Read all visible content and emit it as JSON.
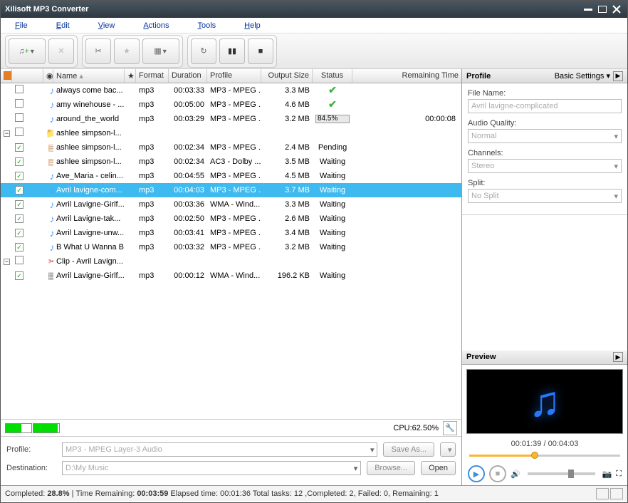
{
  "window": {
    "title": "Xilisoft MP3 Converter"
  },
  "menu": {
    "file": "File",
    "edit": "Edit",
    "view": "View",
    "actions": "Actions",
    "tools": "Tools",
    "help": "Help"
  },
  "columns": {
    "name": "Name",
    "format": "Format",
    "duration": "Duration",
    "profile": "Profile",
    "output": "Output Size",
    "status": "Status",
    "remaining": "Remaining Time"
  },
  "rows": [
    {
      "checked": false,
      "icon": "note",
      "name": "always come bac...",
      "format": "mp3",
      "duration": "00:03:33",
      "profile": "MP3 - MPEG ...",
      "output": "3.3 MB",
      "status": "done"
    },
    {
      "checked": false,
      "icon": "note",
      "name": "amy winehouse - ...",
      "format": "mp3",
      "duration": "00:05:00",
      "profile": "MP3 - MPEG ...",
      "output": "4.6 MB",
      "status": "done"
    },
    {
      "checked": false,
      "icon": "note",
      "name": "around_the_world",
      "format": "mp3",
      "duration": "00:03:29",
      "profile": "MP3 - MPEG ...",
      "output": "3.2 MB",
      "status": "progress",
      "progress": "84.5%",
      "remaining": "00:00:08"
    },
    {
      "checked": false,
      "icon": "folder",
      "name": "ashlee simpson-l...",
      "group": true
    },
    {
      "checked": true,
      "icon": "doc",
      "name": "ashlee simpson-l...",
      "format": "mp3",
      "duration": "00:02:34",
      "profile": "MP3 - MPEG ...",
      "output": "2.4 MB",
      "status": "Pending",
      "indent": true
    },
    {
      "checked": true,
      "icon": "doc",
      "name": "ashlee simpson-l...",
      "format": "mp3",
      "duration": "00:02:34",
      "profile": "AC3 - Dolby ...",
      "output": "3.5 MB",
      "status": "Waiting",
      "indent": true
    },
    {
      "checked": true,
      "icon": "note",
      "name": "Ave_Maria - celin...",
      "format": "mp3",
      "duration": "00:04:55",
      "profile": "MP3 - MPEG ...",
      "output": "4.5 MB",
      "status": "Waiting"
    },
    {
      "checked": true,
      "icon": "note",
      "name": "Avril lavigne-com...",
      "format": "mp3",
      "duration": "00:04:03",
      "profile": "MP3 - MPEG ...",
      "output": "3.7 MB",
      "status": "Waiting",
      "selected": true
    },
    {
      "checked": true,
      "icon": "note",
      "name": "Avril Lavigne-Girlf...",
      "format": "mp3",
      "duration": "00:03:36",
      "profile": "WMA - Wind...",
      "output": "3.3 MB",
      "status": "Waiting"
    },
    {
      "checked": true,
      "icon": "note",
      "name": "Avril Lavigne-tak...",
      "format": "mp3",
      "duration": "00:02:50",
      "profile": "MP3 - MPEG ...",
      "output": "2.6 MB",
      "status": "Waiting"
    },
    {
      "checked": true,
      "icon": "note",
      "name": "Avril Lavigne-unw...",
      "format": "mp3",
      "duration": "00:03:41",
      "profile": "MP3 - MPEG ...",
      "output": "3.4 MB",
      "status": "Waiting"
    },
    {
      "checked": true,
      "icon": "note",
      "name": "B What U Wanna B",
      "format": "mp3",
      "duration": "00:03:32",
      "profile": "MP3 - MPEG ...",
      "output": "3.2 MB",
      "status": "Waiting"
    },
    {
      "checked": false,
      "icon": "scissors",
      "name": "Clip - Avril Lavign...",
      "group": true
    },
    {
      "checked": true,
      "icon": "film",
      "name": "Avril Lavigne-Girlf...",
      "format": "mp3",
      "duration": "00:00:12",
      "profile": "WMA - Wind...",
      "output": "196.2 KB",
      "status": "Waiting",
      "indent": true
    }
  ],
  "cpu": {
    "label": "CPU:62.50%"
  },
  "form": {
    "profile_label": "Profile:",
    "profile_value": "MP3 - MPEG Layer-3 Audio",
    "destination_label": "Destination:",
    "destination_value": "D:\\My Music",
    "saveas": "Save As...",
    "browse": "Browse...",
    "open": "Open"
  },
  "profile": {
    "title": "Profile",
    "mode": "Basic Settings",
    "filename_label": "File Name:",
    "filename_value": "Avril lavigne-complicated",
    "quality_label": "Audio Quality:",
    "quality_value": "Normal",
    "channels_label": "Channels:",
    "channels_value": "Stereo",
    "split_label": "Split:",
    "split_value": "No Split"
  },
  "preview": {
    "title": "Preview",
    "time": "00:01:39 / 00:04:03"
  },
  "statusbar": {
    "completed_label": "Completed:",
    "completed_pct": "28.8%",
    "time_remaining_label": "Time Remaining:",
    "time_remaining": "00:03:59",
    "elapsed": "Elapsed time: 00:01:36 Total tasks: 12 ,Completed: 2, Failed: 0, Remaining: 1"
  }
}
